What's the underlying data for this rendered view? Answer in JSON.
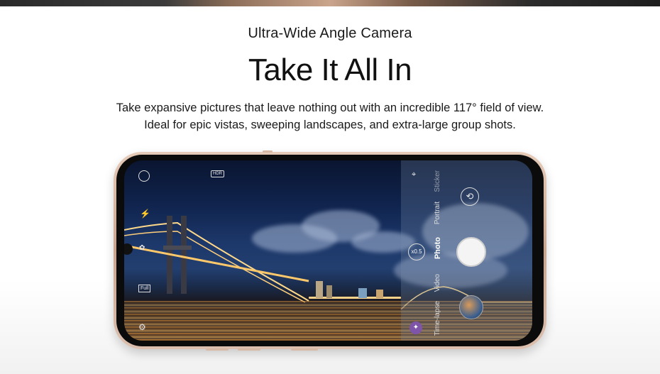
{
  "hero": {
    "eyebrow": "Ultra-Wide Angle Camera",
    "headline": "Take It All In",
    "description_line1": "Take expansive pictures that leave nothing out with an incredible 117° field of view.",
    "description_line2": "Ideal for epic vistas, sweeping landscapes, and extra-large group shots."
  },
  "camera_ui": {
    "hdr_label": "HDR",
    "full_label": "Full",
    "zoom_label": "x0.5",
    "modes": [
      "Time-lapse",
      "Video",
      "Photo",
      "Portrait",
      "Sticker"
    ],
    "active_mode": "Photo"
  },
  "colors": {
    "phone_frame": "#d9b9a5",
    "accent_purple": "#7e55a8"
  }
}
